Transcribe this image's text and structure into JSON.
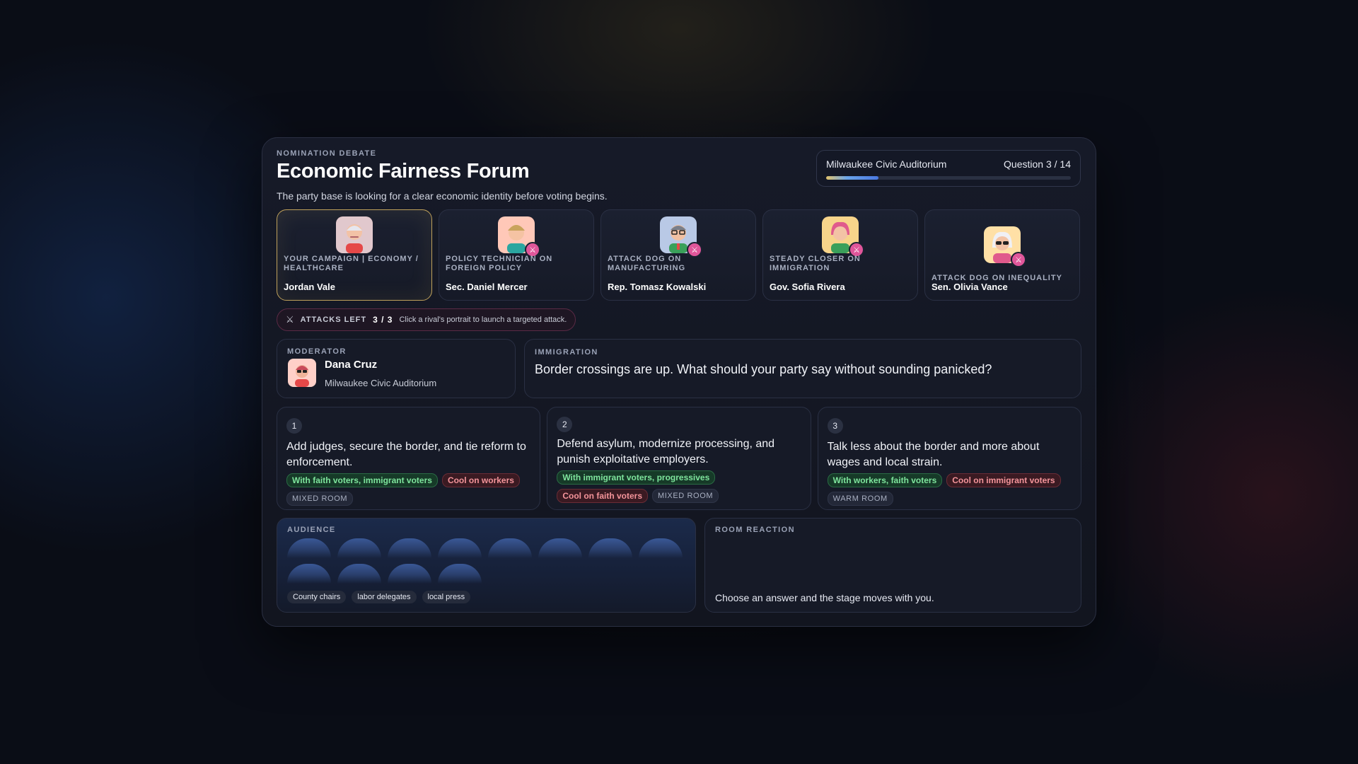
{
  "header": {
    "eyebrow": "NOMINATION DEBATE",
    "title": "Economic Fairness Forum",
    "subtitle": "The party base is looking for a clear economic identity before voting begins."
  },
  "venue": {
    "name": "Milwaukee Civic Auditorium",
    "question_label": "Question 3 / 14",
    "progress_fraction": 0.214
  },
  "candidates": [
    {
      "role": "YOUR CAMPAIGN | ECONOMY / HEALTHCARE",
      "name": "Jordan Vale",
      "is_player": true
    },
    {
      "role": "POLICY TECHNICIAN ON FOREIGN POLICY",
      "name": "Sec. Daniel Mercer",
      "is_player": false
    },
    {
      "role": "ATTACK DOG ON MANUFACTURING",
      "name": "Rep. Tomasz Kowalski",
      "is_player": false
    },
    {
      "role": "STEADY CLOSER ON IMMIGRATION",
      "name": "Gov. Sofia Rivera",
      "is_player": false
    },
    {
      "role": "ATTACK DOG ON INEQUALITY",
      "name": "Sen. Olivia Vance",
      "is_player": false
    }
  ],
  "attacks": {
    "label": "ATTACKS LEFT",
    "count": "3 / 3",
    "hint": "Click a rival's portrait to launch a targeted attack."
  },
  "moderator": {
    "label": "MODERATOR",
    "name": "Dana Cruz",
    "venue": "Milwaukee Civic Auditorium"
  },
  "question": {
    "topic": "IMMIGRATION",
    "text": "Border crossings are up. What should your party say without sounding panicked?"
  },
  "answers": [
    {
      "num": "1",
      "text": "Add judges, secure the border, and tie reform to enforcement.",
      "good": "With faith voters, immigrant voters",
      "bad": "Cool on workers",
      "room": "MIXED ROOM"
    },
    {
      "num": "2",
      "text": "Defend asylum, modernize processing, and punish exploitative employers.",
      "good": "With immigrant voters, progressives",
      "bad": "Cool on faith voters",
      "room": "MIXED ROOM"
    },
    {
      "num": "3",
      "text": "Talk less about the border and more about wages and local strain.",
      "good": "With workers, faith voters",
      "bad": "Cool on immigrant voters",
      "room": "WARM ROOM"
    }
  ],
  "audience": {
    "label": "AUDIENCE",
    "seat_count": 12,
    "chips": [
      "County chairs",
      "labor delegates",
      "local press"
    ]
  },
  "reaction": {
    "label": "ROOM REACTION",
    "text": "Choose an answer and the stage moves with you."
  },
  "colors": {
    "accent_gold": "#bfa15b",
    "attack_pink": "#e0569a",
    "good_green": "#7ee49c",
    "bad_red": "#f4949a"
  },
  "icons": {
    "attack": "swords-icon",
    "badge": "swords-badge-icon"
  }
}
